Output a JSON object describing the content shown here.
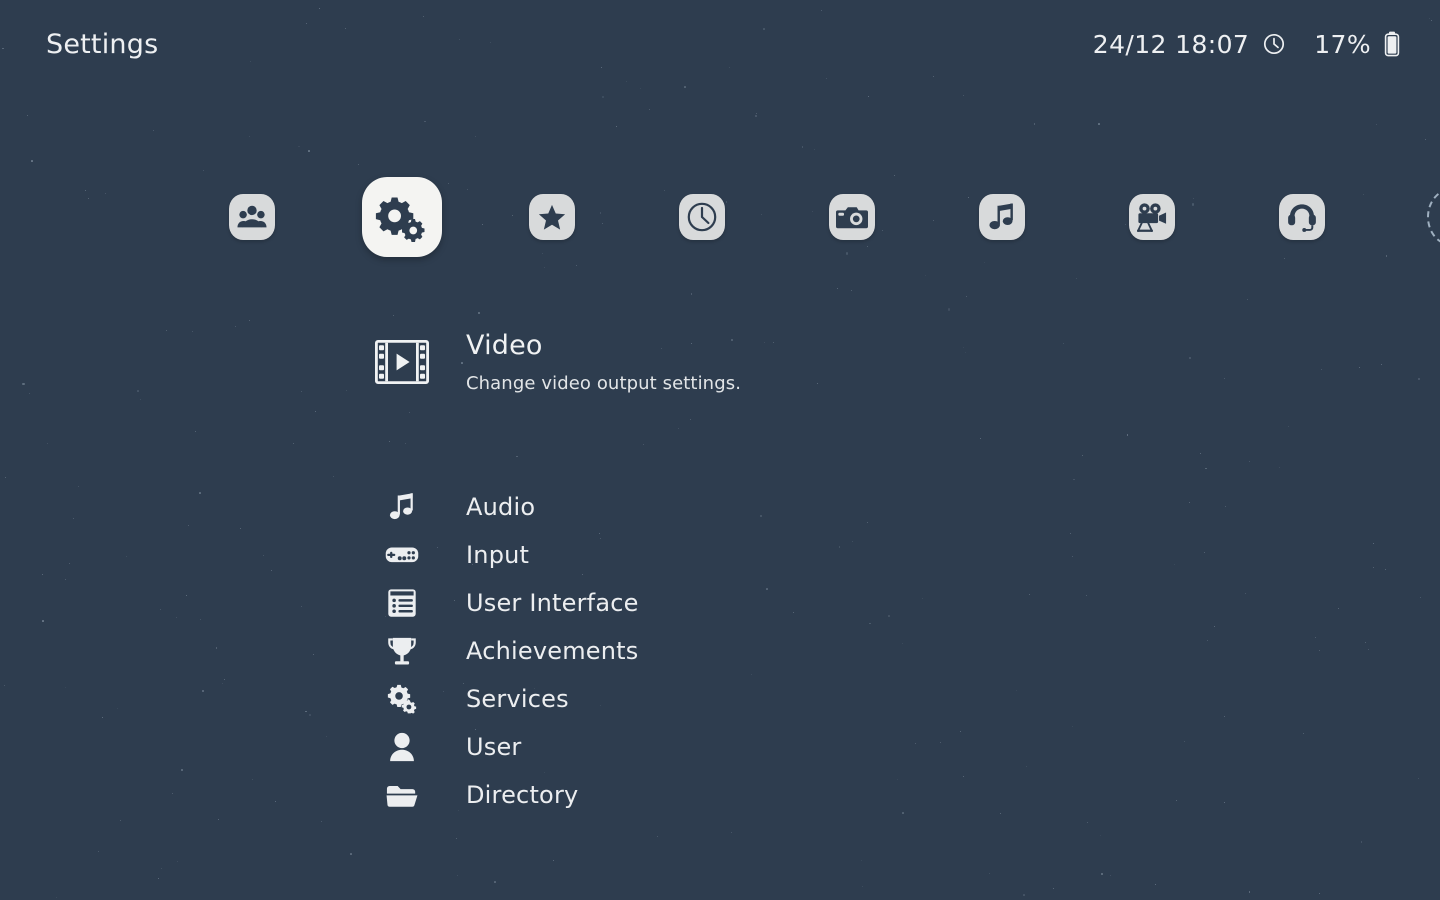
{
  "app": {
    "title": "Settings"
  },
  "status": {
    "datetime": "24/12 18:07",
    "clock_icon": "clock-icon",
    "battery_percent": "17%",
    "battery_icon": "battery-icon"
  },
  "carousel": {
    "selected_index": 1,
    "items": [
      {
        "icon": "people-group-icon",
        "name": "collections",
        "selected": false
      },
      {
        "icon": "gears-icon",
        "name": "settings",
        "selected": true
      },
      {
        "icon": "star-icon",
        "name": "favorites",
        "selected": false
      },
      {
        "icon": "clock-icon",
        "name": "recents",
        "selected": false
      },
      {
        "icon": "camera-icon",
        "name": "screenshots",
        "selected": false
      },
      {
        "icon": "music-note-icon",
        "name": "music",
        "selected": false
      },
      {
        "icon": "movie-camera-icon",
        "name": "videos",
        "selected": false
      },
      {
        "icon": "headset-icon",
        "name": "audio-devices",
        "selected": false
      },
      {
        "icon": "dashed-circle-icon",
        "name": "more",
        "selected": false
      }
    ]
  },
  "feature": {
    "icon": "film-play-icon",
    "title": "Video",
    "subtitle": "Change video output settings."
  },
  "menu": {
    "items": [
      {
        "icon": "music-note-icon",
        "label": "Audio"
      },
      {
        "icon": "gamepad-icon",
        "label": "Input"
      },
      {
        "icon": "list-view-icon",
        "label": "User Interface"
      },
      {
        "icon": "trophy-icon",
        "label": "Achievements"
      },
      {
        "icon": "gears-icon",
        "label": "Services"
      },
      {
        "icon": "person-icon",
        "label": "User"
      },
      {
        "icon": "folder-open-icon",
        "label": "Directory"
      }
    ]
  },
  "colors": {
    "background": "#2e3d4f",
    "text": "#eceef0",
    "tile": "#d8dadb",
    "tile_selected": "#f4f4f2",
    "icon_dark": "#2e3d4f"
  }
}
